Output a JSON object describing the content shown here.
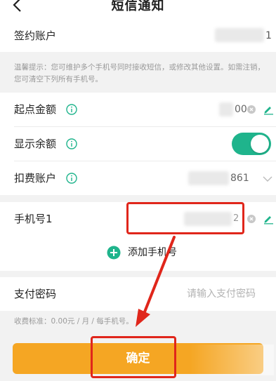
{
  "header": {
    "title": "短信通知"
  },
  "account": {
    "label": "签约账户",
    "value_suffix": "1"
  },
  "notice": {
    "text": "温馨提示：您可维护多个手机号同时接收短信，或修改其他设置。如需注销，您可清空下列所有手机号。"
  },
  "threshold": {
    "label": "起点金额",
    "value_suffix": "00"
  },
  "show_balance": {
    "label": "显示余额",
    "enabled": true
  },
  "fee_account": {
    "label": "扣费账户",
    "value_suffix": "861"
  },
  "phone": {
    "label": "手机号1",
    "value_suffix": "2"
  },
  "add_phone": {
    "label": "添加手机号"
  },
  "pay_password": {
    "label": "支付密码",
    "placeholder": "请输入支付密码"
  },
  "fee_note": {
    "text": "收费标准：0.00元 / 月 / 每手机号。"
  },
  "confirm": {
    "label": "确定"
  },
  "colors": {
    "accent_green": "#1fb48c",
    "button_orange": "#f5a623",
    "highlight_red": "#e0261b"
  }
}
